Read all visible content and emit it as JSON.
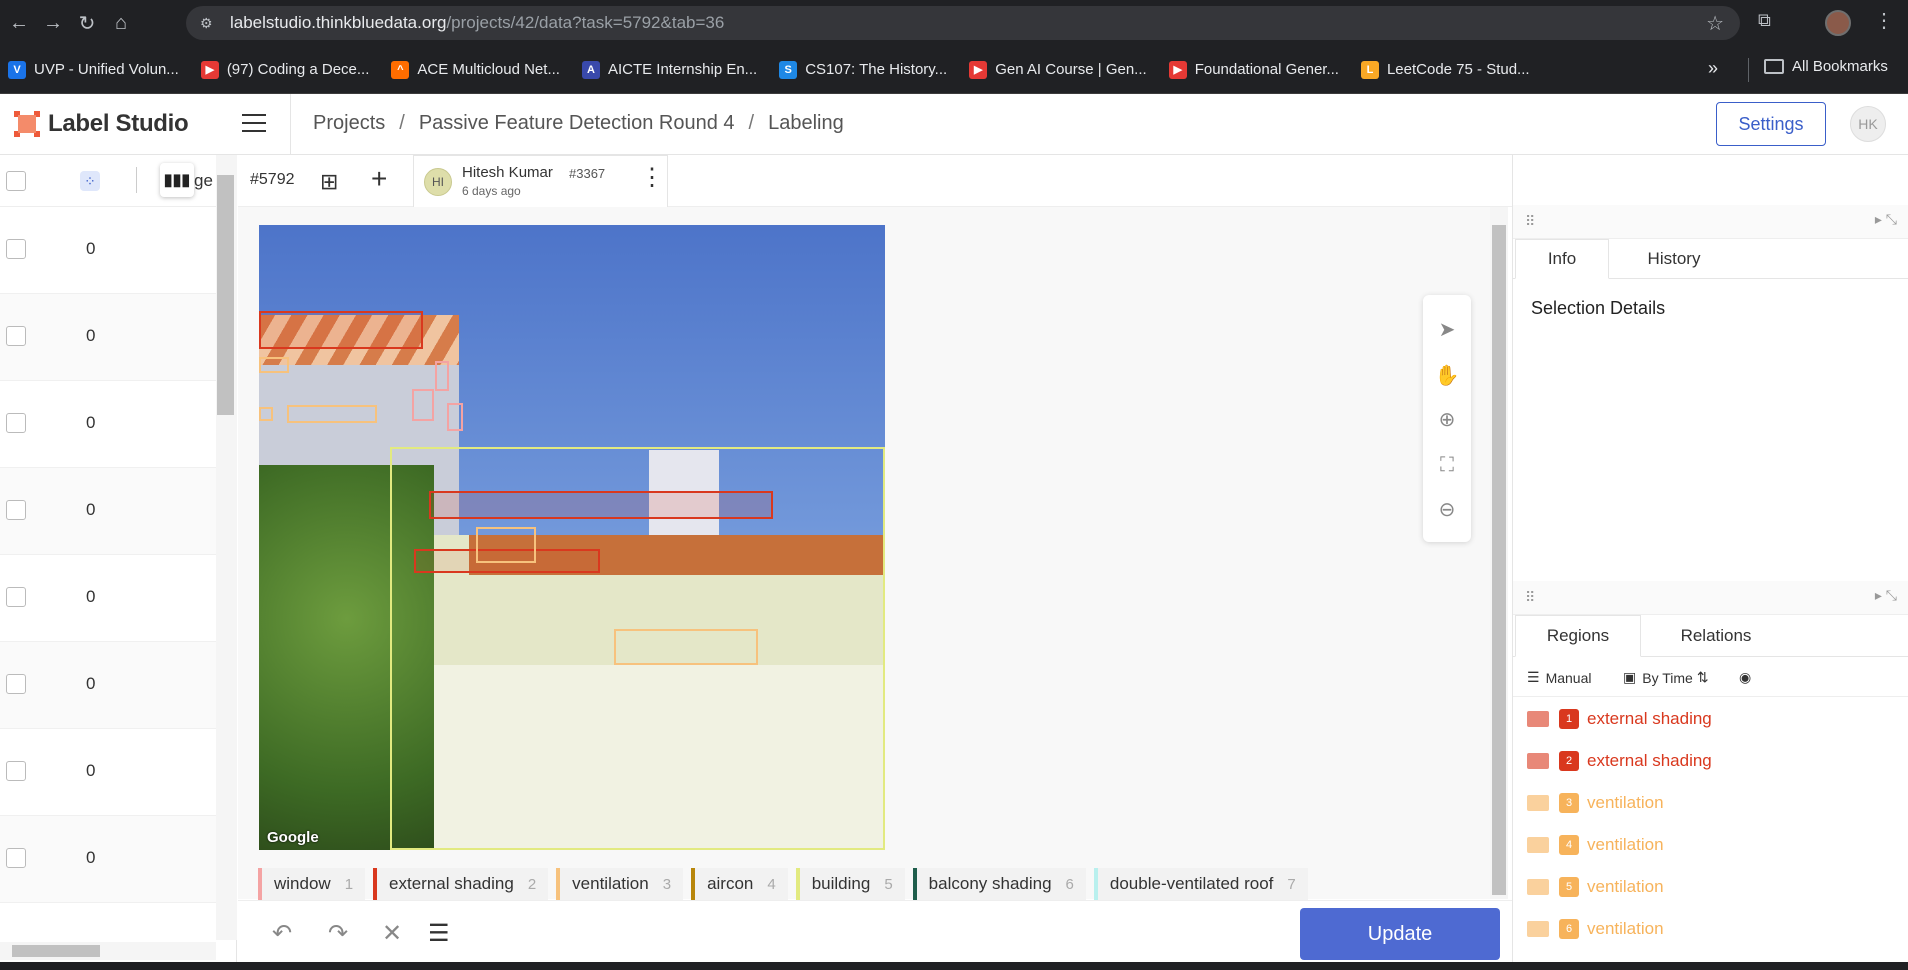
{
  "browser": {
    "url_host": "labelstudio.thinkbluedata.org",
    "url_path": "/projects/42/data?task=5792&tab=36",
    "bookmarks": [
      {
        "label": "UVP - Unified Volun...",
        "color": "#1a73e8",
        "glyph": "V"
      },
      {
        "label": "(97) Coding a Dece...",
        "color": "#e53935",
        "glyph": "▶"
      },
      {
        "label": "ACE Multicloud Net...",
        "color": "#ff6d00",
        "glyph": "^"
      },
      {
        "label": "AICTE Internship En...",
        "color": "#3949ab",
        "glyph": "A"
      },
      {
        "label": "CS107: The History...",
        "color": "#1e88e5",
        "glyph": "S"
      },
      {
        "label": "Gen AI Course | Gen...",
        "color": "#e53935",
        "glyph": "▶"
      },
      {
        "label": "Foundational Gener...",
        "color": "#e53935",
        "glyph": "▶"
      },
      {
        "label": "LeetCode 75 - Stud...",
        "color": "#f9a825",
        "glyph": "L"
      }
    ],
    "more": "»",
    "all_bookmarks": "All Bookmarks"
  },
  "app": {
    "logo": "Label Studio",
    "breadcrumb": [
      "Projects",
      "Passive Feature Detection Round 4",
      "Labeling"
    ],
    "settings": "Settings",
    "user_initials": "HK"
  },
  "left_list": {
    "column_partial": "ge",
    "rows": [
      "0",
      "0",
      "0",
      "0",
      "0",
      "0",
      "0",
      "0"
    ]
  },
  "task": {
    "id": "#5792",
    "annotator": {
      "initials": "HI",
      "name": "Hitesh Kumar",
      "number": "#3367",
      "time": "6 days ago"
    }
  },
  "image": {
    "watermark": "Google"
  },
  "labels": [
    {
      "name": "window",
      "key": "1",
      "color": "#f4a3a3"
    },
    {
      "name": "external shading",
      "key": "2",
      "color": "#d9381e"
    },
    {
      "name": "ventilation",
      "key": "3",
      "color": "#f7c27d"
    },
    {
      "name": "aircon",
      "key": "4",
      "color": "#b8860b"
    },
    {
      "name": "building",
      "key": "5",
      "color": "#e2ea80"
    },
    {
      "name": "balcony shading",
      "key": "6",
      "color": "#1f5e4c"
    },
    {
      "name": "double-ventilated roof",
      "key": "7",
      "color": "#b9f0ee"
    }
  ],
  "bottom": {
    "update": "Update"
  },
  "right_panel": {
    "tabs_top": [
      "Info",
      "History"
    ],
    "selection_details": "Selection Details",
    "tabs_bottom": [
      "Regions",
      "Relations"
    ],
    "toolbar": {
      "manual": "Manual",
      "sort": "By Time"
    },
    "regions": [
      {
        "num": "1",
        "name": "external shading",
        "color": "#d9381e"
      },
      {
        "num": "2",
        "name": "external shading",
        "color": "#d9381e"
      },
      {
        "num": "3",
        "name": "ventilation",
        "color": "#f7b35b"
      },
      {
        "num": "4",
        "name": "ventilation",
        "color": "#f7b35b"
      },
      {
        "num": "5",
        "name": "ventilation",
        "color": "#f7b35b"
      },
      {
        "num": "6",
        "name": "ventilation",
        "color": "#f7b35b"
      }
    ]
  }
}
